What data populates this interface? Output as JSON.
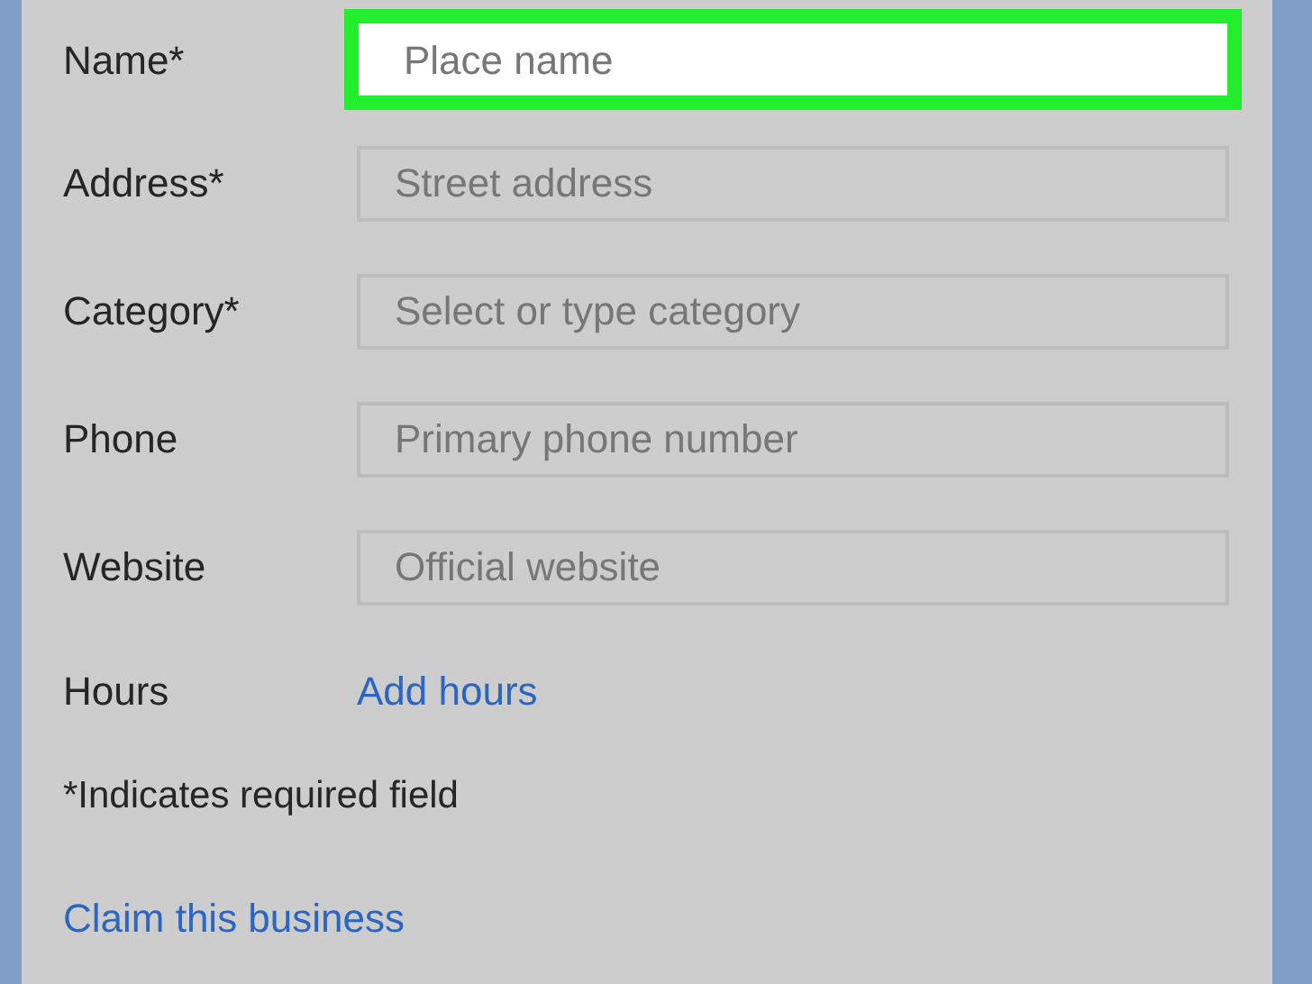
{
  "form": {
    "fields": [
      {
        "label": "Name*",
        "placeholder": "Place name",
        "highlighted": true
      },
      {
        "label": "Address*",
        "placeholder": "Street address",
        "highlighted": false
      },
      {
        "label": "Category*",
        "placeholder": "Select or type category",
        "highlighted": false
      },
      {
        "label": "Phone",
        "placeholder": "Primary phone number",
        "highlighted": false
      },
      {
        "label": "Website",
        "placeholder": "Official website",
        "highlighted": false
      }
    ],
    "hours": {
      "label": "Hours",
      "link": "Add hours"
    },
    "note": "*Indicates required field",
    "claim_link": "Claim this business"
  }
}
